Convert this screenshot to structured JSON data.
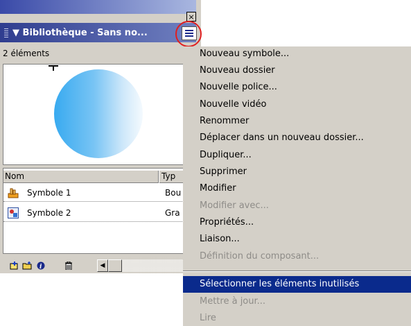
{
  "panel": {
    "close_glyph": "×",
    "header_title": "Bibliothèque - Sans no...",
    "collapse_glyph": "▼",
    "count": "2 éléments",
    "columns": [
      "Nom",
      "Typ"
    ],
    "items": [
      {
        "name": "Symbole 1",
        "type": "Bou",
        "icon": "button-symbol-icon"
      },
      {
        "name": "Symbole 2",
        "type": "Gra",
        "icon": "graphic-symbol-icon"
      }
    ],
    "preview_fill_colors": [
      "#38aaf0",
      "#f4fafe"
    ],
    "scroll_left": "◀",
    "scroll_right": "▶"
  },
  "menu": {
    "items": [
      {
        "label": "Nouveau symbole...",
        "enabled": true
      },
      {
        "label": "Nouveau dossier",
        "enabled": true
      },
      {
        "label": "Nouvelle police...",
        "enabled": true
      },
      {
        "label": "Nouvelle vidéo",
        "enabled": true
      },
      {
        "label": "Renommer",
        "enabled": true
      },
      {
        "label": "Déplacer dans un nouveau dossier...",
        "enabled": true
      },
      {
        "label": "Dupliquer...",
        "enabled": true
      },
      {
        "label": "Supprimer",
        "enabled": true
      },
      {
        "label": "Modifier",
        "enabled": true
      },
      {
        "label": "Modifier avec...",
        "enabled": false
      },
      {
        "label": "Propriétés...",
        "enabled": true
      },
      {
        "label": "Liaison...",
        "enabled": true
      },
      {
        "label": "Définition du composant...",
        "enabled": false
      },
      {
        "label": "Sélectionner les éléments inutilisés",
        "enabled": true,
        "highlighted": true
      },
      {
        "label": "Mettre à jour...",
        "enabled": false
      },
      {
        "label": "Lire",
        "enabled": false
      }
    ],
    "highlight_color": "#0a2a8c"
  }
}
